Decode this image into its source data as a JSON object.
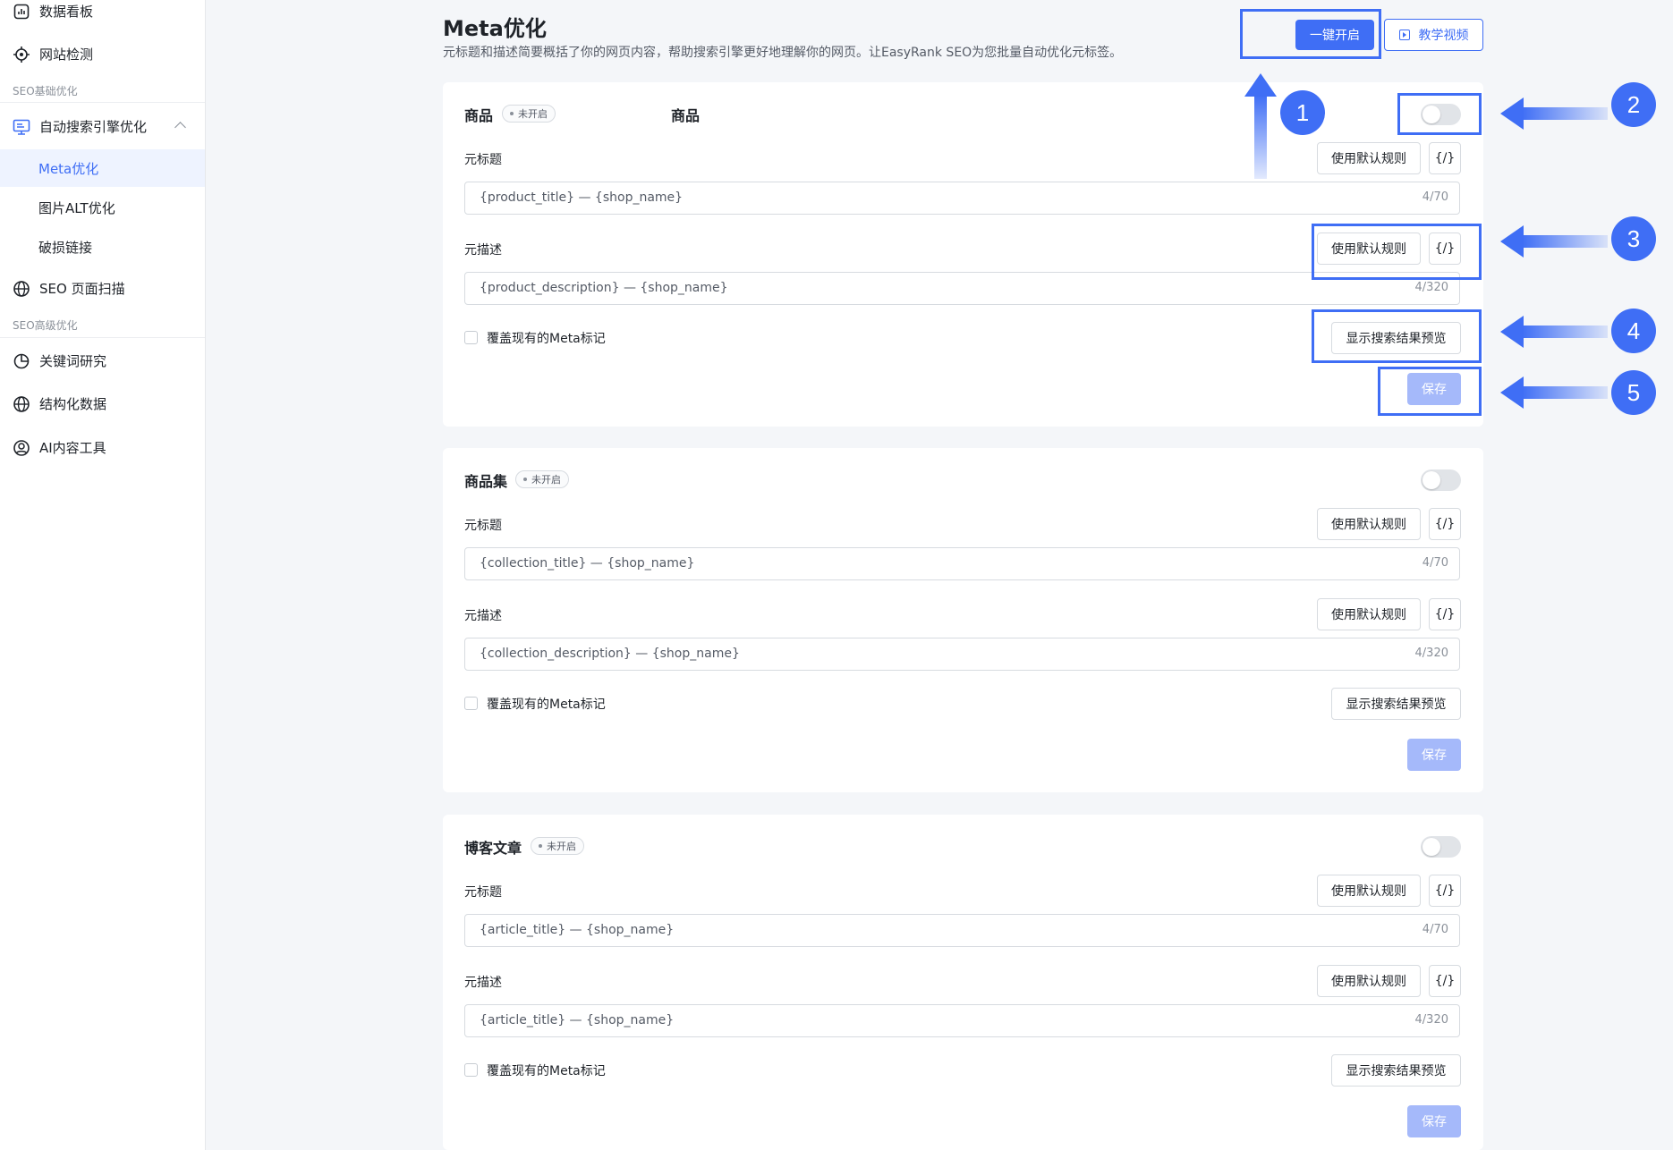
{
  "sidebar": {
    "dashboard": {
      "icon": "chart-icon",
      "label": "数据看板"
    },
    "site_check": {
      "icon": "target-icon",
      "label": "网站检测"
    },
    "group_basic": "SEO基础优化",
    "auto_seo": {
      "icon": "monitor-icon",
      "label": "自动搜索引擎优化"
    },
    "sub_items": [
      "Meta优化",
      "图片ALT优化",
      "破损链接"
    ],
    "seo_scan": {
      "icon": "globe-icon",
      "label": "SEO 页面扫描"
    },
    "group_advanced": "SEO高级优化",
    "keyword": {
      "icon": "pie-icon",
      "label": "关键词研究"
    },
    "structured": {
      "icon": "globe-icon",
      "label": "结构化数据"
    },
    "ai_tool": {
      "icon": "user-circle-icon",
      "label": "AI内容工具"
    }
  },
  "header": {
    "title": "Meta优化",
    "description": "元标题和描述简要概括了你的网页内容，帮助搜索引擎更好地理解你的网页。让EasyRank SEO为您批量自动优化元标签。",
    "enable_all": "一键开启",
    "tutorial": "教学视频"
  },
  "cards": [
    {
      "title": "商品",
      "status": "未开启",
      "meta_title_label": "元标题",
      "meta_title_value": "{product_title} — {shop_name}",
      "meta_title_count": "4/70",
      "meta_desc_label": "元描述",
      "meta_desc_value": "{product_description} — {shop_name}",
      "meta_desc_count": "4/320",
      "default_rule": "使用默认规则",
      "var_btn": "{/}",
      "overwrite": "覆盖现有的Meta标记",
      "preview": "显示搜索结果预览",
      "save": "保存"
    },
    {
      "title": "商品集",
      "status": "未开启",
      "meta_title_label": "元标题",
      "meta_title_value": "{collection_title} — {shop_name}",
      "meta_title_count": "4/70",
      "meta_desc_label": "元描述",
      "meta_desc_value": "{collection_description} — {shop_name}",
      "meta_desc_count": "4/320",
      "default_rule": "使用默认规则",
      "var_btn": "{/}",
      "overwrite": "覆盖现有的Meta标记",
      "preview": "显示搜索结果预览",
      "save": "保存"
    },
    {
      "title": "博客文章",
      "status": "未开启",
      "meta_title_label": "元标题",
      "meta_title_value": "{article_title} — {shop_name}",
      "meta_title_count": "4/70",
      "meta_desc_label": "元描述",
      "meta_desc_value": "{article_title} — {shop_name}",
      "meta_desc_count": "4/320",
      "default_rule": "使用默认规则",
      "var_btn": "{/}",
      "overwrite": "覆盖现有的Meta标记",
      "preview": "显示搜索结果预览",
      "save": "保存"
    }
  ],
  "annotations": [
    "1",
    "2",
    "3",
    "4",
    "5"
  ],
  "colors": {
    "accent": "#3f6ef5",
    "save_disabled": "#a5b9fa"
  }
}
